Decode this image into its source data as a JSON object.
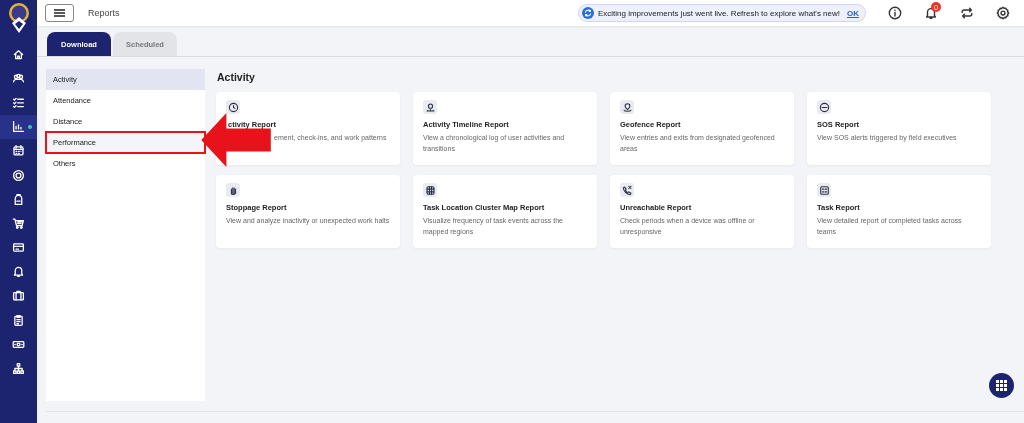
{
  "nav_items": [
    {
      "selected": false
    },
    {
      "selected": false
    },
    {
      "selected": false
    },
    {
      "selected": true
    },
    {
      "selected": false
    },
    {
      "selected": false
    },
    {
      "selected": false
    },
    {
      "selected": false
    },
    {
      "selected": false
    },
    {
      "selected": false
    },
    {
      "selected": false
    },
    {
      "selected": false
    },
    {
      "selected": false
    },
    {
      "selected": false
    }
  ],
  "top_bar": {
    "title": "Reports",
    "banner": {
      "text": "Exciting improvements just went live. Refresh to explore what's new!",
      "link": "OK"
    },
    "notification_count": "0"
  },
  "tabs": [
    {
      "label": "Download",
      "selected": true
    },
    {
      "label": "Scheduled",
      "selected": false
    }
  ],
  "categories": [
    {
      "label": "Activity",
      "selected": true,
      "highlighted": false
    },
    {
      "label": "Attendance",
      "selected": false,
      "highlighted": false
    },
    {
      "label": "Distance",
      "selected": false,
      "highlighted": false
    },
    {
      "label": "Performance",
      "selected": false,
      "highlighted": true
    },
    {
      "label": "Others",
      "selected": false,
      "highlighted": false
    }
  ],
  "section_title": "Activity",
  "reports": [
    {
      "title": "ctivity Report",
      "description": "ement, check-ins, and work patterns",
      "covered": true
    },
    {
      "title": "Activity Timeline Report",
      "description": "View a chronological log of user activities and transitions",
      "covered": false
    },
    {
      "title": "Geofence Report",
      "description": "View entries and exits from designated geofenced areas",
      "covered": false
    },
    {
      "title": "SOS Report",
      "description": "View SOS alerts triggered by field executives",
      "covered": false
    },
    {
      "title": "Stoppage Report",
      "description": "View and analyze inactivity or unexpected work halts",
      "covered": false
    },
    {
      "title": "Task Location Cluster Map Report",
      "description": "Visualize frequency of task events across the mapped regions",
      "covered": false
    },
    {
      "title": "Unreachable Report",
      "description": "Check periods when a device was offline or unresponsive",
      "covered": false
    },
    {
      "title": "Task Report",
      "description": "View detailed report of completed tasks across teams",
      "covered": false
    }
  ]
}
